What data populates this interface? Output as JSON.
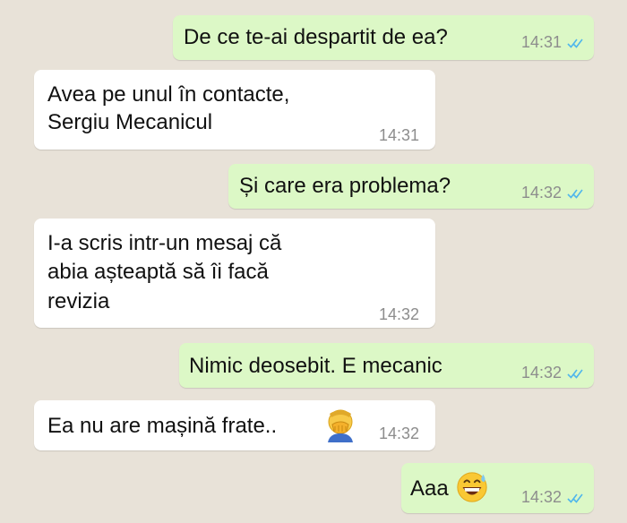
{
  "colors": {
    "background": "#e8e2d8",
    "incoming_bubble": "#ffffff",
    "outgoing_bubble": "#dcf8c6",
    "timestamp": "#8d8d8d",
    "read_ticks": "#4fb6ec"
  },
  "messages": [
    {
      "direction": "outgoing",
      "text": "De ce te-ai despartit de ea?",
      "time": "14:31",
      "status": "read"
    },
    {
      "direction": "incoming",
      "text_lines": [
        "Avea pe unul în contacte,",
        "Sergiu Mecanicul"
      ],
      "time": "14:31"
    },
    {
      "direction": "outgoing",
      "text": "Și care era problema?",
      "time": "14:32",
      "status": "read"
    },
    {
      "direction": "incoming",
      "text_lines": [
        "I-a scris intr-un mesaj că",
        "abia așteaptă să îi facă",
        "revizia"
      ],
      "time": "14:32"
    },
    {
      "direction": "outgoing",
      "text": "Nimic deosebit. E mecanic",
      "time": "14:32",
      "status": "read"
    },
    {
      "direction": "incoming",
      "text": "Ea nu are mașină frate..",
      "emoji": "face-palm-emoji",
      "time": "14:32"
    },
    {
      "direction": "outgoing",
      "text": "Aaa",
      "emoji": "grinning-sweat-emoji",
      "time": "14:32",
      "status": "read"
    }
  ]
}
